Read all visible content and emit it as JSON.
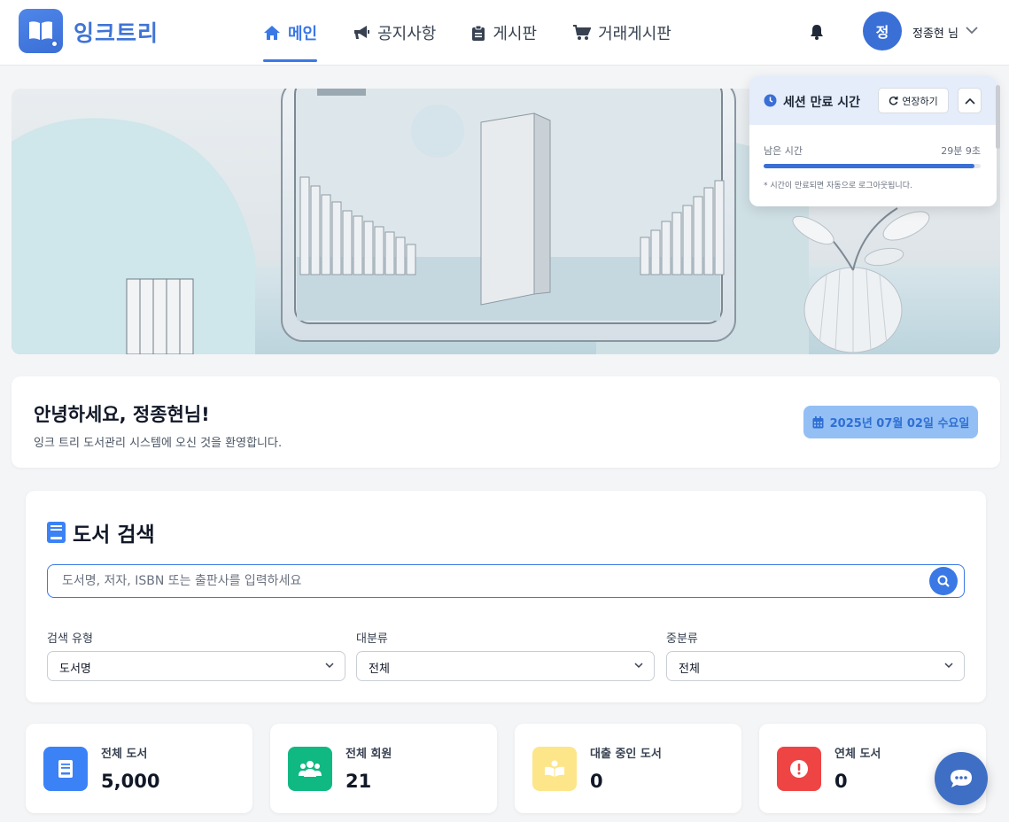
{
  "header": {
    "logo_text": "잉크트리",
    "nav": [
      {
        "label": "메인",
        "icon": "home-icon",
        "active": true
      },
      {
        "label": "공지사항",
        "icon": "megaphone-icon",
        "active": false
      },
      {
        "label": "게시판",
        "icon": "clipboard-icon",
        "active": false
      },
      {
        "label": "거래게시판",
        "icon": "cart-icon",
        "active": false
      }
    ],
    "avatar_initial": "정",
    "user_name": "정종현 님"
  },
  "session": {
    "title": "세션 만료 시간",
    "extend_label": "연장하기",
    "remaining_label": "남은 시간",
    "remaining_value": "29분 9초",
    "progress_percent": 97,
    "note": "* 시간이 만료되면 자동으로 로그아웃됩니다."
  },
  "welcome": {
    "title": "안녕하세요, 정종현님!",
    "subtitle": "잉크 트리 도서관리 시스템에 오신 것을 환영합니다.",
    "date": "2025년 07월 02일 수요일"
  },
  "search": {
    "heading": "도서 검색",
    "placeholder": "도서명, 저자, ISBN 또는 출판사를 입력하세요",
    "value": "",
    "filters": [
      {
        "label": "검색 유형",
        "selected": "도서명"
      },
      {
        "label": "대분류",
        "selected": "전체"
      },
      {
        "label": "중분류",
        "selected": "전체"
      }
    ]
  },
  "stats": [
    {
      "label": "전체 도서",
      "value": "5,000",
      "icon": "book-icon",
      "color": "#3b82f6"
    },
    {
      "label": "전체 회원",
      "value": "21",
      "icon": "users-icon",
      "color": "#10b981"
    },
    {
      "label": "대출 중인 도서",
      "value": "0",
      "icon": "reading-icon",
      "color": "#fde68a"
    },
    {
      "label": "연체 도서",
      "value": "0",
      "icon": "alert-icon",
      "color": "#ef4444"
    }
  ],
  "colors": {
    "primary": "#3a78e6",
    "brand": "#3f74d6"
  }
}
